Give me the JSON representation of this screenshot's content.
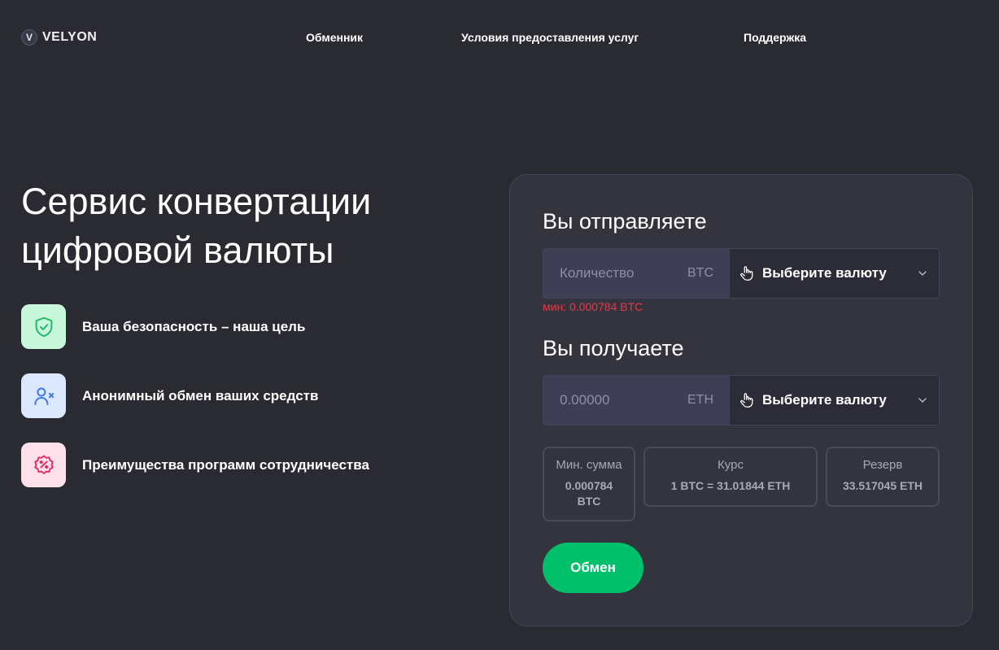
{
  "header": {
    "logo_letter": "V",
    "logo_text": "VELYON",
    "nav": [
      "Обменник",
      "Условия предоставления услуг",
      "Поддержка"
    ]
  },
  "hero": {
    "title_line1": "Сервис конвертации",
    "title_line2": "цифровой валюты",
    "features": [
      {
        "icon": "shield-check-icon",
        "text": "Ваша безопасность – наша цель",
        "bg": "#c9f7dc",
        "color": "#1fb864"
      },
      {
        "icon": "user-x-icon",
        "text": "Анонимный обмен ваших средств",
        "bg": "#dce8fd",
        "color": "#3f7be8"
      },
      {
        "icon": "discount-badge-icon",
        "text": "Преимущества программ сотрудничества",
        "bg": "#fde1ea",
        "color": "#e0306e"
      }
    ]
  },
  "exchange": {
    "send_title": "Вы отправляете",
    "send_placeholder": "Количество",
    "send_ticker": "BTC",
    "send_select": "Выберите валюту",
    "min_note": "мин: 0.000784 BTC",
    "receive_title": "Вы получаете",
    "receive_value": "0.00000",
    "receive_ticker": "ETH",
    "receive_select": "Выберите валюту",
    "min_sum_label": "Мин. сумма",
    "min_sum_value_line1": "0.000784",
    "min_sum_value_line2": "BTC",
    "rate_label": "Курс",
    "rate_value": "1 BTC = 31.01844 ETH",
    "reserve_label": "Резерв",
    "reserve_value": "33.517045 ETH",
    "button": "Обмен"
  },
  "colors": {
    "background": "#2a2a33",
    "card": "#34343e",
    "accent_green": "#00c06b",
    "error_red": "#e03b4a"
  }
}
